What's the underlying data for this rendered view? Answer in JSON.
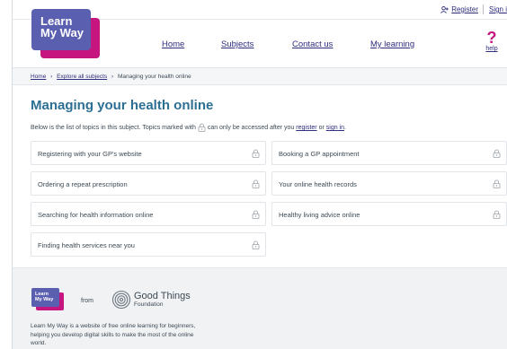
{
  "header": {
    "register": "Register",
    "signin": "Sign i",
    "logo": {
      "line1": "Learn",
      "line2": "My Way"
    },
    "nav": [
      "Home",
      "Subjects",
      "Contact us",
      "My learning"
    ],
    "help": {
      "symbol": "?",
      "label": "help"
    }
  },
  "breadcrumb": {
    "items": [
      "Home",
      "Explore all subjects",
      "Managing your health online"
    ]
  },
  "main": {
    "title": "Managing your health online",
    "intro_before": "Below is the list of topics in this subject. Topics marked with",
    "intro_middle": "can only be accessed after you",
    "register_link": "register",
    "intro_or": "or",
    "signin_link": "sign in",
    "intro_end": ".",
    "topics": [
      "Registering with your GP's website",
      "Booking a GP appointment",
      "Ordering a repeat prescription",
      "Your online health records",
      "Searching for health information online",
      "Healthy living advice online",
      "Finding health services near you"
    ]
  },
  "footer": {
    "logo": {
      "line1": "Learn",
      "line2": "My Way"
    },
    "from": "from",
    "partner": {
      "name": "Good Things",
      "sub": "Foundation"
    },
    "description": "Learn My Way is a website of free online learning for beginners, helping you develop digital skills to make the most of the online world."
  },
  "colors": {
    "brand_purple": "#5b5fb0",
    "brand_pink": "#c6157f",
    "link": "#2f2d7e",
    "title": "#2d6f93"
  }
}
